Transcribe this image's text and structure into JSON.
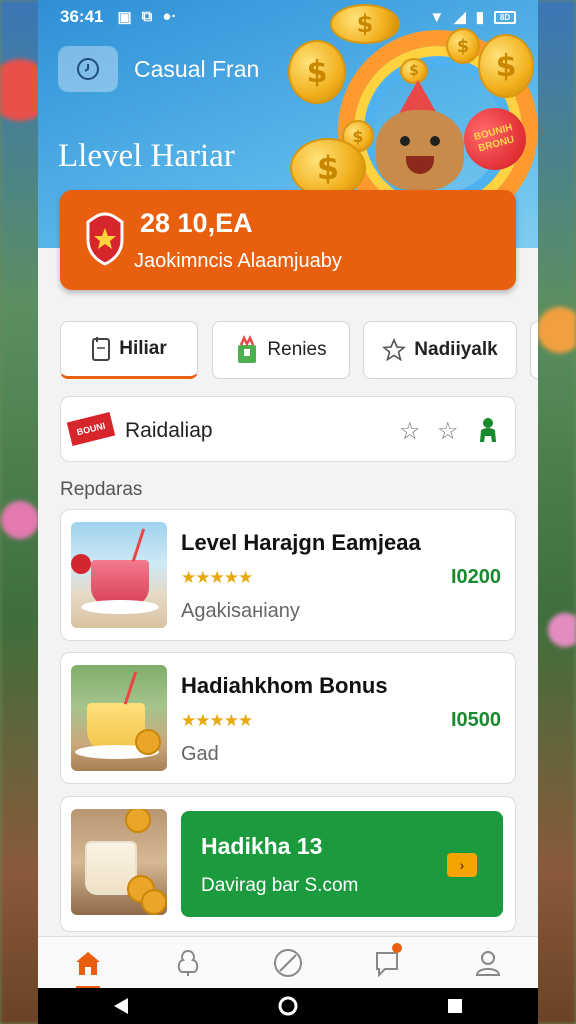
{
  "status": {
    "time": "36:41",
    "battery": "8D"
  },
  "header": {
    "app_title": "Casual Fran",
    "level_title": "Llevel Hariar",
    "badge_text": "BOUNIH BRONU"
  },
  "hero": {
    "amount": "28 10,EA",
    "subtitle": "Jaokimncis Alaamjuaby"
  },
  "tabs": [
    {
      "label": "Hiliar",
      "icon": "document-icon",
      "active": true
    },
    {
      "label": "Renies",
      "icon": "gift-box-icon",
      "active": false
    },
    {
      "label": "Nadiiyalk",
      "icon": "star-outline-icon",
      "active": false
    }
  ],
  "filter": {
    "flag_text": "BOUNI",
    "label": "Raidaliap"
  },
  "section_label": "Repdaras",
  "items": [
    {
      "name": "Level Harajgn Eamjeaa",
      "stars": "★★★★★",
      "rating": 4,
      "price": "I0200",
      "meta": "Agakisaнiany"
    },
    {
      "name": "Hadiahkhom Bonus",
      "stars": "★★★★★",
      "rating": 4,
      "price": "I0500",
      "meta": "Gad"
    }
  ],
  "promo": {
    "title": "Hadikha 13",
    "subtitle": "Davirag bar S.com"
  },
  "colors": {
    "accent": "#e8600f",
    "promo_green": "#1c9b3e",
    "price_green": "#1a8a2e",
    "header_blue": "#2e8fd6"
  }
}
